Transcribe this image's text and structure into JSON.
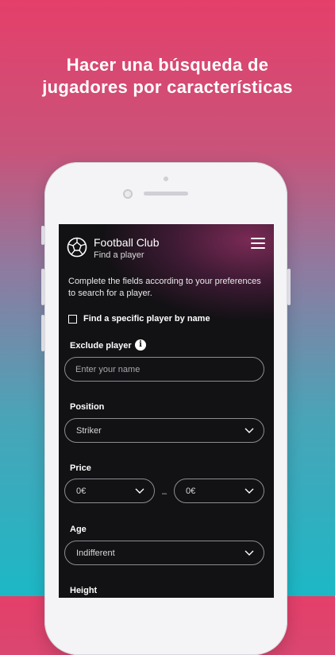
{
  "headline": {
    "line1": "Hacer una búsqueda de",
    "line2": "jugadores por características"
  },
  "app": {
    "title": "Football Club",
    "subtitle": "Find a player"
  },
  "intro_text": "Complete the fields according to your preferences to search for a player.",
  "find_by_name": {
    "label": "Find a specific player by name",
    "checked": false
  },
  "exclude_player": {
    "label": "Exclude player",
    "placeholder": "Enter your name",
    "value": ""
  },
  "position": {
    "label": "Position",
    "selected": "Striker"
  },
  "price": {
    "label": "Price",
    "min": "0€",
    "separator": "–",
    "max": "0€"
  },
  "age": {
    "label": "Age",
    "selected": "Indifferent"
  },
  "height": {
    "label": "Height"
  },
  "icons": {
    "logo": "football-ball-icon",
    "menu": "hamburger-menu-icon",
    "info": "info-icon",
    "dropdown": "chevron-down-icon"
  },
  "colors": {
    "bg_top": "#e43f6a",
    "bg_bottom": "#1cb8c6",
    "screen_bg": "#121114",
    "field_border": "#8d8d92"
  }
}
